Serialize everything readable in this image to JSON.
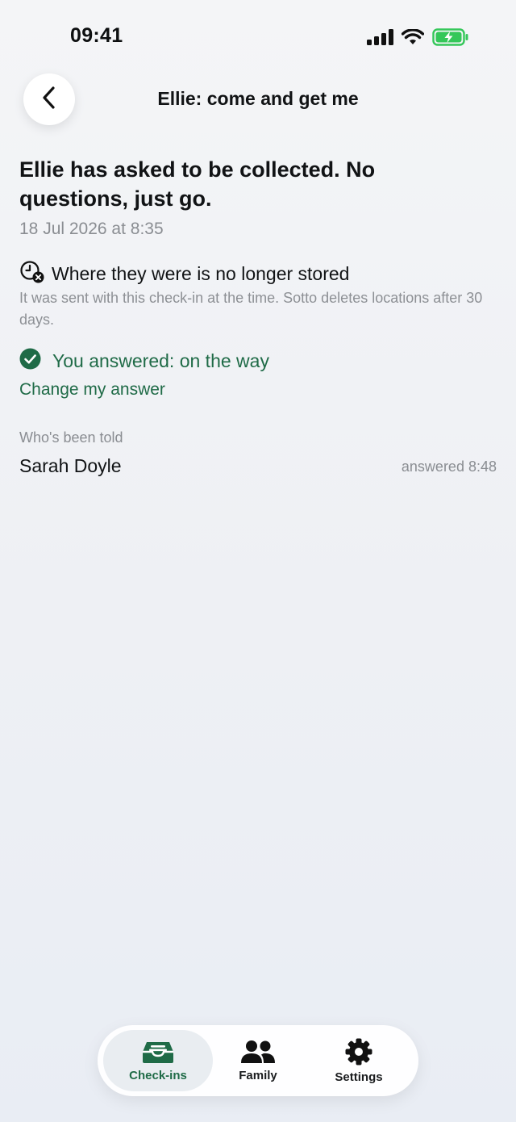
{
  "status_bar": {
    "time": "09:41",
    "icons": [
      "cellular-signal-icon",
      "wifi-icon",
      "battery-charging-icon"
    ],
    "battery_color": "#34c759"
  },
  "header": {
    "title": "Ellie: come and get me",
    "back_icon": "chevron-left-icon"
  },
  "checkin": {
    "headline": "Ellie has asked to be collected. No questions, just go.",
    "timestamp": "18 Jul 2026 at 8:35"
  },
  "location": {
    "icon": "clock-deleted-icon",
    "title": "Where they were is no longer stored",
    "note": "It was sent with this check-in at the time. Sotto deletes locations after 30 days."
  },
  "answer": {
    "icon": "check-circle-icon",
    "text": "You answered: on the way",
    "change_label": "Change my answer",
    "accent_color": "#1f6b47"
  },
  "recipients": {
    "label": "Who's been told",
    "items": [
      {
        "name": "Sarah Doyle",
        "status": "answered 8:48"
      }
    ]
  },
  "tab_bar": {
    "tabs": [
      {
        "label": "Check-ins",
        "icon": "inbox-tray-icon",
        "active": true
      },
      {
        "label": "Family",
        "icon": "people-icon",
        "active": false
      },
      {
        "label": "Settings",
        "icon": "gear-icon",
        "active": false
      }
    ]
  }
}
